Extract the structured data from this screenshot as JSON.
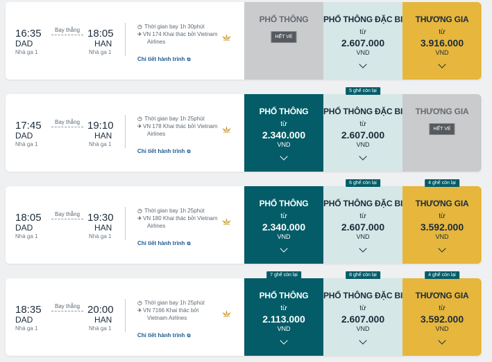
{
  "labels": {
    "nonstop": "Bay thẳng",
    "from": "từ",
    "currency": "VND",
    "sold_out": "HẾT VÉ",
    "details": "Chi tiết hành trình"
  },
  "flights": [
    {
      "dep_time": "16:35",
      "arr_time": "18:05",
      "dep_code": "DAD",
      "arr_code": "HAN",
      "dep_term": "Nhà ga 1",
      "arr_term": "Nhà ga 1",
      "duration": "Thời gian bay 1h 30phút",
      "flight_l1": "VN 174 Khai thác bởi Vietnam",
      "flight_l2": "Airlines",
      "fares": [
        {
          "title": "PHỔ THÔNG",
          "status": "sold",
          "price": "",
          "seats": ""
        },
        {
          "title": "PHỔ THÔNG ĐẶC BIỆT",
          "status": "available",
          "price": "2.607.000",
          "seats": ""
        },
        {
          "title": "THƯƠNG GIA",
          "status": "available",
          "price": "3.916.000",
          "seats": ""
        }
      ]
    },
    {
      "dep_time": "17:45",
      "arr_time": "19:10",
      "dep_code": "DAD",
      "arr_code": "HAN",
      "dep_term": "Nhà ga 1",
      "arr_term": "Nhà ga 1",
      "duration": "Thời gian bay 1h 25phút",
      "flight_l1": "VN 178 Khai thác bởi Vietnam",
      "flight_l2": "Airlines",
      "fares": [
        {
          "title": "PHỔ THÔNG",
          "status": "selected",
          "price": "2.340.000",
          "seats": ""
        },
        {
          "title": "PHỔ THÔNG ĐẶC BIỆT",
          "status": "available",
          "price": "2.607.000",
          "seats": "5 ghế còn lại"
        },
        {
          "title": "THƯƠNG GIA",
          "status": "sold",
          "price": "",
          "seats": ""
        }
      ]
    },
    {
      "dep_time": "18:05",
      "arr_time": "19:30",
      "dep_code": "DAD",
      "arr_code": "HAN",
      "dep_term": "Nhà ga 1",
      "arr_term": "Nhà ga 1",
      "duration": "Thời gian bay 1h 25phút",
      "flight_l1": "VN 180 Khai thác bởi Vietnam",
      "flight_l2": "Airlines",
      "fares": [
        {
          "title": "PHỔ THÔNG",
          "status": "selected",
          "price": "2.340.000",
          "seats": ""
        },
        {
          "title": "PHỔ THÔNG ĐẶC BIỆT",
          "status": "available",
          "price": "2.607.000",
          "seats": "6 ghế còn lại"
        },
        {
          "title": "THƯƠNG GIA",
          "status": "available",
          "price": "3.592.000",
          "seats": "4 ghế còn lại"
        }
      ]
    },
    {
      "dep_time": "18:35",
      "arr_time": "20:00",
      "dep_code": "DAD",
      "arr_code": "HAN",
      "dep_term": "Nhà ga 1",
      "arr_term": "Nhà ga 1",
      "duration": "Thời gian bay 1h 25phút",
      "flight_l1": "VN 7166 Khai thác bởi",
      "flight_l2": "Vietnam Airlines",
      "fares": [
        {
          "title": "PHỔ THÔNG",
          "status": "selected",
          "price": "2.113.000",
          "seats": "7 ghế còn lại"
        },
        {
          "title": "PHỔ THÔNG ĐẶC BIỆT",
          "status": "available",
          "price": "2.607.000",
          "seats": "8 ghế còn lại"
        },
        {
          "title": "THƯƠNG GIA",
          "status": "available",
          "price": "3.592.000",
          "seats": "4 ghế còn lại"
        }
      ]
    }
  ],
  "colors": {
    "economy_selected": "#035c67",
    "deluxe": "#d6e7e7",
    "business": "#e6b63d",
    "sold_out": "#c9cbcd",
    "link": "#1d5a8f"
  }
}
